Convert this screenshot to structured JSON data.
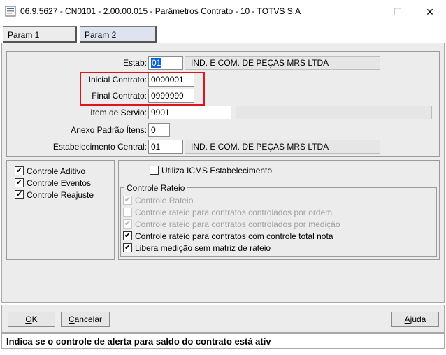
{
  "window": {
    "title": "06.9.5627 - CN0101 - 2.00.00.015 - Parâmetros Contrato - 10 - TOTVS S.A",
    "minimize_glyph": "—",
    "maximize_glyph": "☐",
    "close_glyph": "✕"
  },
  "tabs": [
    {
      "label": "Param 1",
      "active": true
    },
    {
      "label": "Param 2",
      "active": false
    }
  ],
  "form": {
    "estab": {
      "label": "Estab:",
      "value": "01",
      "description": "IND. E COM. DE PEÇAS MRS LTDA"
    },
    "inicial_contrato": {
      "label": "Inicial Contrato:",
      "value": "0000001"
    },
    "final_contrato": {
      "label": "Final Contrato:",
      "value": "0999999"
    },
    "item_servio": {
      "label": "Item de Servio:",
      "value": "9901",
      "description": ""
    },
    "anexo_padrao": {
      "label": "Anexo Padrão Ítens:",
      "value": "0"
    },
    "estab_central": {
      "label": "Estabelecimento Central:",
      "value": "01",
      "description": "IND. E COM. DE PEÇAS MRS LTDA"
    }
  },
  "left_checks": [
    {
      "label": "Controle Aditivo",
      "checked": true
    },
    {
      "label": "Controle Eventos",
      "checked": true
    },
    {
      "label": "Controle Reajuste",
      "checked": true
    }
  ],
  "icms_check": {
    "label": "Utiliza ICMS Estabelecimento",
    "checked": false
  },
  "rateio": {
    "title": "Controle Rateio",
    "items": [
      {
        "label": "Controle Rateio",
        "checked": true,
        "enabled": false
      },
      {
        "label": "Controle rateio para contratos controlados por ordem",
        "checked": false,
        "enabled": false
      },
      {
        "label": "Controle rateio para contratos controlados por medição",
        "checked": true,
        "enabled": false
      },
      {
        "label": "Controle rateio para contratos com controle total nota",
        "checked": true,
        "enabled": true
      },
      {
        "label": "Libera medição sem matriz de rateio",
        "checked": true,
        "enabled": true
      }
    ]
  },
  "buttons": {
    "ok": {
      "mnemonic": "O",
      "rest": "K"
    },
    "cancelar": {
      "mnemonic": "C",
      "rest": "ancelar"
    },
    "ajuda": {
      "mnemonic": "A",
      "rest": "juda"
    }
  },
  "status": "Indica se o controle de alerta para saldo do contrato está ativ",
  "colors": {
    "highlight_box": "#e0141e",
    "selection": "#0a64d6"
  }
}
